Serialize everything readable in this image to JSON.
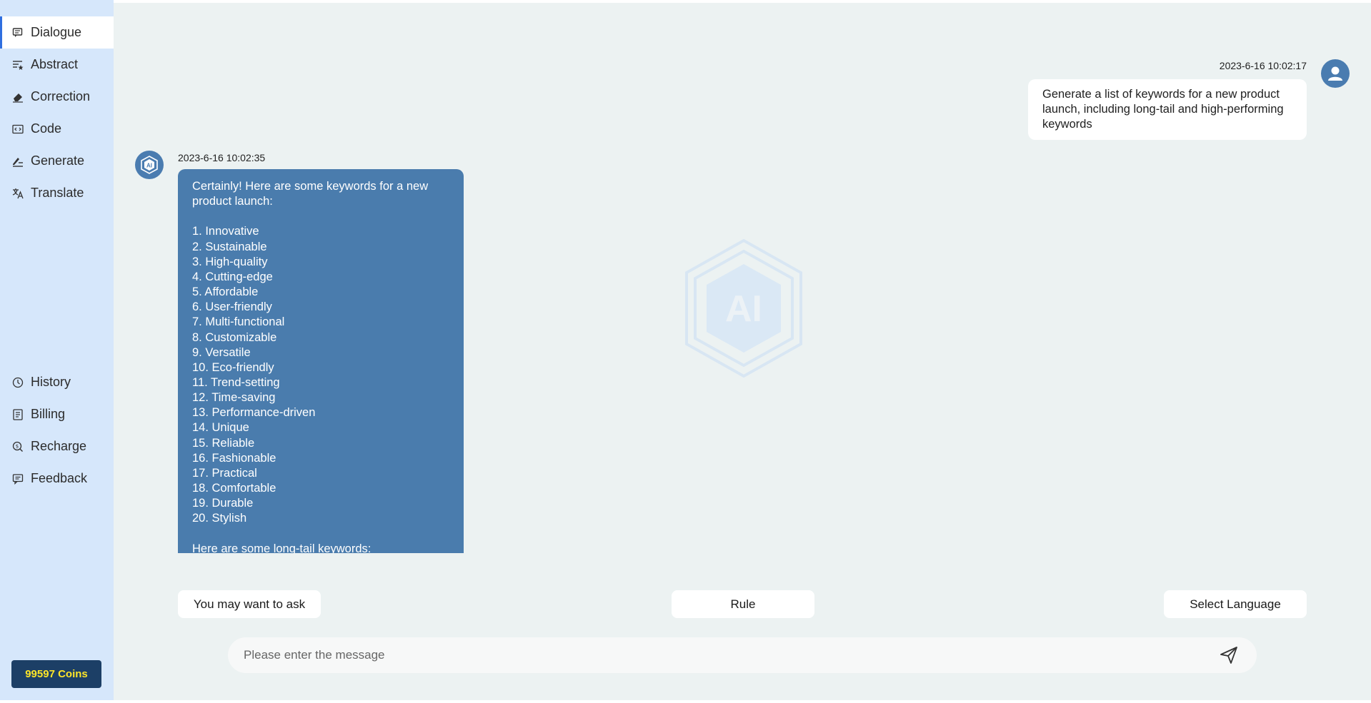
{
  "sidebar": {
    "top_items": [
      {
        "label": "Dialogue",
        "icon": "chat-bubble-icon"
      },
      {
        "label": "Abstract",
        "icon": "list-star-icon"
      },
      {
        "label": "Correction",
        "icon": "eraser-icon"
      },
      {
        "label": "Code",
        "icon": "code-window-icon"
      },
      {
        "label": "Generate",
        "icon": "pen-lines-icon"
      },
      {
        "label": "Translate",
        "icon": "translate-icon"
      }
    ],
    "active": "Dialogue",
    "bottom_items": [
      {
        "label": "History",
        "icon": "clock-icon"
      },
      {
        "label": "Billing",
        "icon": "receipt-icon"
      },
      {
        "label": "Recharge",
        "icon": "coin-recharge-icon"
      },
      {
        "label": "Feedback",
        "icon": "feedback-message-icon"
      }
    ],
    "coins": "99597 Coins"
  },
  "chat": {
    "user_message": {
      "time": "2023-6-16 10:02:17",
      "text": "Generate a list of keywords for a new product launch, including long-tail and high-performing keywords"
    },
    "ai_message": {
      "time": "2023-6-16 10:02:35",
      "lines": [
        "Certainly! Here are some keywords for a new product launch:",
        "",
        "1. Innovative",
        "2. Sustainable",
        "3. High-quality",
        "4. Cutting-edge",
        "5. Affordable",
        "6. User-friendly",
        "7. Multi-functional",
        "8. Customizable",
        "9. Versatile",
        "10. Eco-friendly",
        "11. Trend-setting",
        "12. Time-saving",
        "13. Performance-driven",
        "14. Unique",
        "15. Reliable",
        "16. Fashionable",
        "17. Practical",
        "18. Comfortable",
        "19. Durable",
        "20. Stylish",
        "",
        "Here are some long-tail keywords:"
      ]
    },
    "ai_avatar_text": "AI",
    "watermark_text": "AI"
  },
  "actions": {
    "ask": "You may want to ask",
    "rule": "Rule",
    "language": "Select Language"
  },
  "composer": {
    "placeholder": "Please enter the message",
    "send_icon": "send-icon"
  },
  "colors": {
    "sidebar_bg": "#d6e7fb",
    "main_bg": "#ecf2f2",
    "ai_bubble": "#4a7cad",
    "coins_bg": "#1c3f66",
    "coins_text": "#ffe628",
    "active_indicator": "#2f6fe0"
  }
}
